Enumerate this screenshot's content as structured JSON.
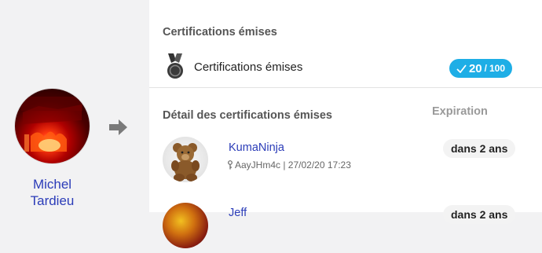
{
  "profile": {
    "name_line1": "Michel",
    "name_line2": "Tardieu",
    "avatar_icon": "profile-photo"
  },
  "issued": {
    "section_title": "Certifications émises",
    "label": "Certifications émises",
    "count": "20",
    "separator": "/",
    "total": "100",
    "badge_icon": "check-icon",
    "badge_color": "#1eaee6"
  },
  "details": {
    "section_title": "Détail des certifications émises",
    "expiration_header": "Expiration",
    "items": [
      {
        "name": "KumaNinja",
        "meta": "AayJHm4c | 27/02/20 17:23",
        "meta_icon": "key-icon",
        "expiration": "dans 2 ans"
      },
      {
        "name": "Jeff",
        "meta": "",
        "meta_icon": "key-icon",
        "expiration": "dans 2 ans"
      }
    ]
  },
  "colors": {
    "link": "#2b3cb8",
    "accent": "#1eaee6"
  }
}
